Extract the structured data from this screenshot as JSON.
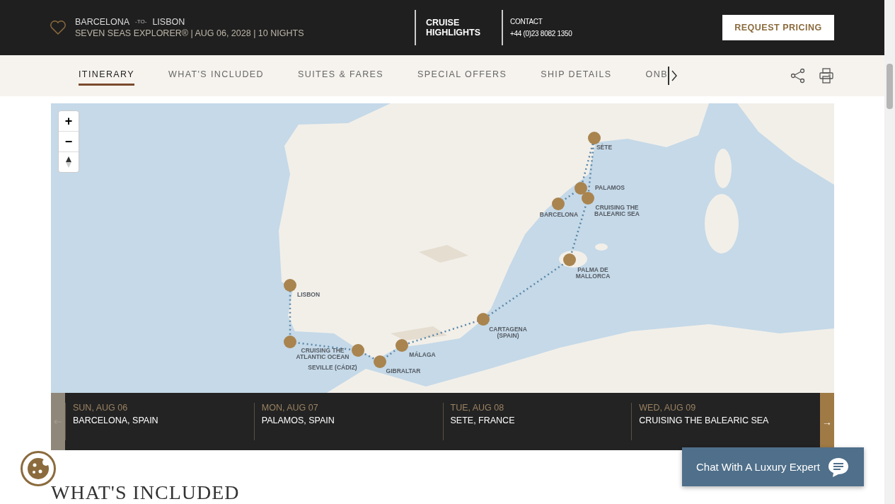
{
  "header": {
    "origin": "BARCELONA",
    "to": "-TO-",
    "destination": "LISBON",
    "details": "SEVEN SEAS EXPLORER® | AUG 06, 2028 | 10 NIGHTS",
    "highlights": "CRUISE HIGHLIGHTS",
    "contact_label": "CONTACT",
    "phone": "+44 (0)23 8082 1350",
    "cta": "REQUEST PRICING"
  },
  "tabs": [
    {
      "label": "ITINERARY",
      "selected": true
    },
    {
      "label": "WHAT'S INCLUDED",
      "selected": false
    },
    {
      "label": "SUITES & FARES",
      "selected": false
    },
    {
      "label": "SPECIAL OFFERS",
      "selected": false
    },
    {
      "label": "SHIP DETAILS",
      "selected": false
    },
    {
      "label": "ONB",
      "selected": false
    }
  ],
  "map": {
    "kind": "picture",
    "zoom_in": "+",
    "zoom_out": "−",
    "ports": [
      {
        "name": "SÈTE"
      },
      {
        "name": "PALAMOS"
      },
      {
        "name": "BARCELONA"
      },
      {
        "name": "CRUISING THE BALEARIC SEA"
      },
      {
        "name": "PALMA DE MALLORCA"
      },
      {
        "name": "LISBON"
      },
      {
        "name": "CARTAGENA (SPAIN)"
      },
      {
        "name": "CRUISING THE ATLANTIC OCEAN"
      },
      {
        "name": "MÁLAGA"
      },
      {
        "name": "SEVILLE (CÁDIZ)"
      },
      {
        "name": "GIBRALTAR"
      }
    ]
  },
  "days": [
    {
      "date": "SUN, AUG 06",
      "place": "BARCELONA, SPAIN"
    },
    {
      "date": "MON, AUG 07",
      "place": "PALAMOS, SPAIN"
    },
    {
      "date": "TUE, AUG 08",
      "place": "SETE, FRANCE"
    },
    {
      "date": "WED, AUG 09",
      "place": "CRUISING THE BALEARIC SEA"
    }
  ],
  "next_arrow": "→",
  "chat": "Chat With A Luxury Expert",
  "section_heading": "WHAT'S INCLUDED"
}
